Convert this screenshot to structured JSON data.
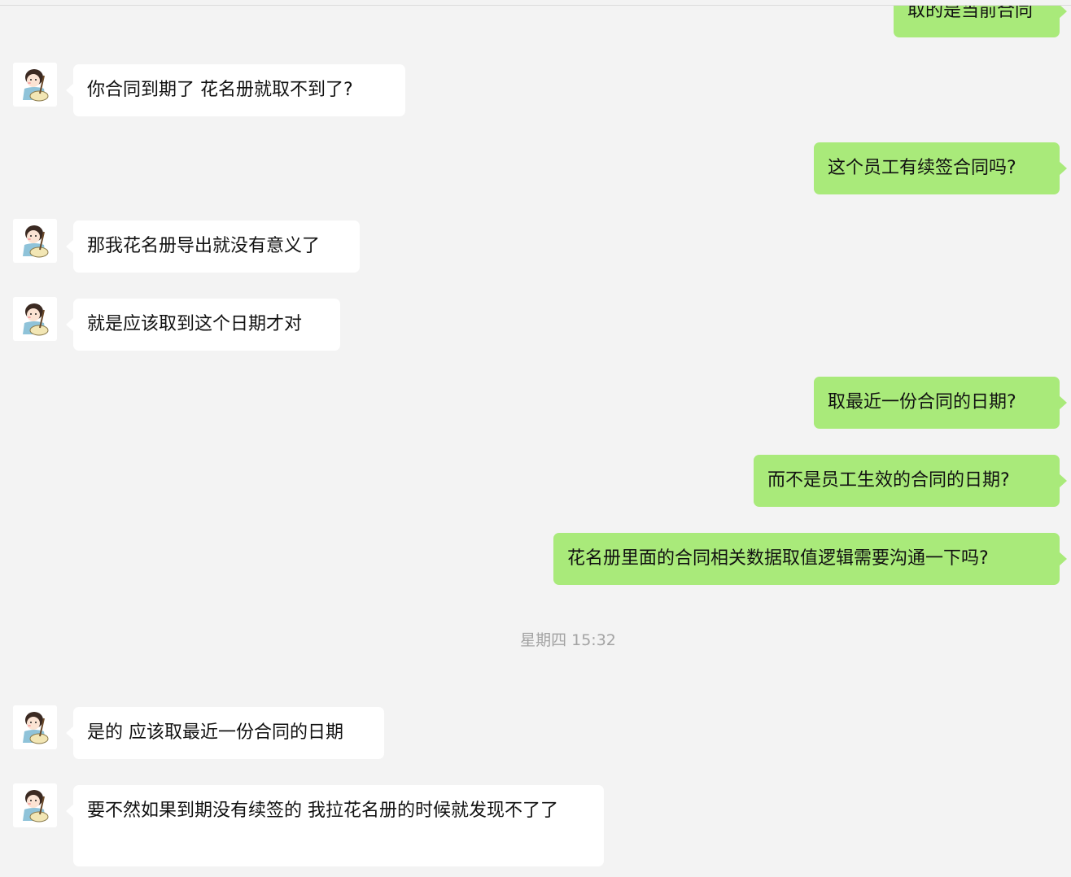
{
  "chat": {
    "messages": [
      {
        "side": "right",
        "text": "取的是当前合同"
      },
      {
        "side": "left",
        "text": "你合同到期了 花名册就取不到了?"
      },
      {
        "side": "right",
        "text": "这个员工有续签合同吗?"
      },
      {
        "side": "left",
        "text": "那我花名册导出就没有意义了"
      },
      {
        "side": "left",
        "text": "就是应该取到这个日期才对"
      },
      {
        "side": "right",
        "text": "取最近一份合同的日期?"
      },
      {
        "side": "right",
        "text": "而不是员工生效的合同的日期?"
      },
      {
        "side": "right",
        "text": "花名册里面的合同相关数据取值逻辑需要沟通一下吗?"
      },
      {
        "side": "left",
        "text": "是的 应该取最近一份合同的日期"
      },
      {
        "side": "left",
        "text": "要不然如果到期没有续签的 我拉花名册的时候就发现不了了"
      }
    ],
    "timestamp": "星期四 15:32"
  },
  "colors": {
    "background": "#f3f3f3",
    "sent_bubble": "#a9ea7a",
    "received_bubble": "#ffffff",
    "timestamp_text": "#a3a3a3"
  },
  "icons": {
    "contact_avatar": "avatar-girl-cooking-icon"
  }
}
